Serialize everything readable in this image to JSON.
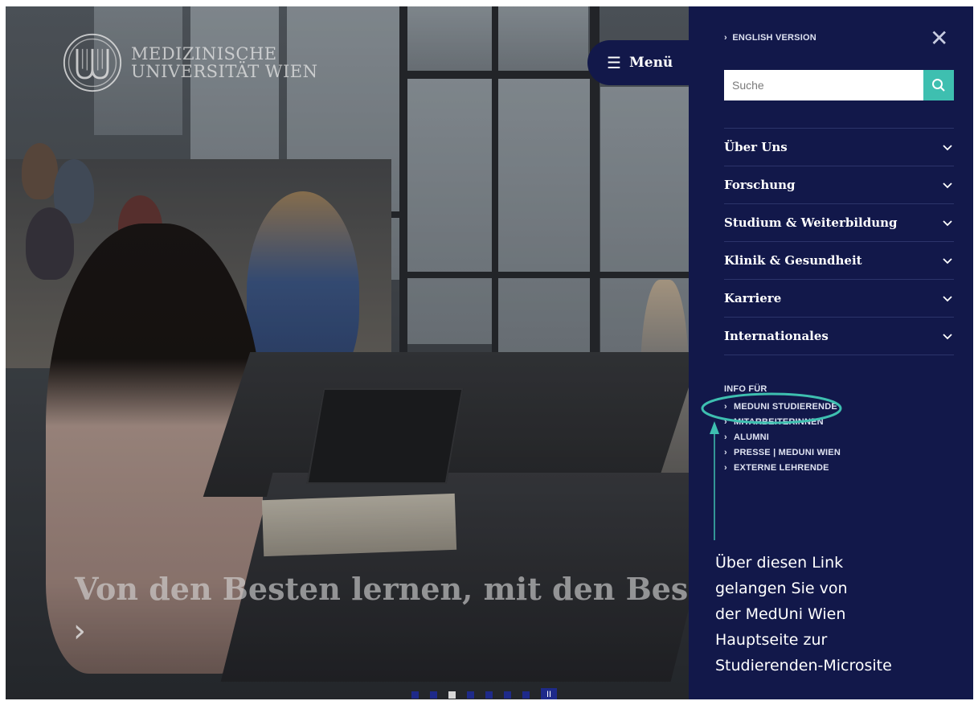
{
  "hero": {
    "logo_line1": "MEDIZINISCHE",
    "logo_line2": "UNIVERSITÄT WIEN",
    "headline": "Von den Besten lernen, mit den Besten st",
    "next_arrow": "›",
    "menu_label": "Menü",
    "menu_icon": "hamburger-icon",
    "slide_count": 7,
    "active_slide": 2,
    "pause_label": "II"
  },
  "panel": {
    "english_link": "ENGLISH VERSION",
    "close_icon": "close-icon",
    "search_placeholder": "Suche",
    "search_icon": "search-icon",
    "nav_items": [
      {
        "label": "Über Uns"
      },
      {
        "label": "Forschung"
      },
      {
        "label": "Studium & Weiterbildung"
      },
      {
        "label": "Klinik & Gesundheit"
      },
      {
        "label": "Karriere"
      },
      {
        "label": "Internationales"
      }
    ],
    "info_heading": "INFO FÜR",
    "info_links": [
      {
        "label": "MEDUNI STUDIERENDE"
      },
      {
        "label": "MITARBEITERINNEN"
      },
      {
        "label": "ALUMNI"
      },
      {
        "label": "PRESSE | MEDUNI WIEN"
      },
      {
        "label": "EXTERNE LEHRENDE"
      }
    ],
    "annotation_lines": [
      "Über diesen Link",
      "gelangen Sie von",
      "der MedUni Wien",
      "Hauptseite zur",
      "Studierenden-Microsite"
    ]
  },
  "colors": {
    "panel_bg": "#12184a",
    "accent_teal": "#3ebfb0",
    "dot_blue": "#1e2a8a"
  }
}
